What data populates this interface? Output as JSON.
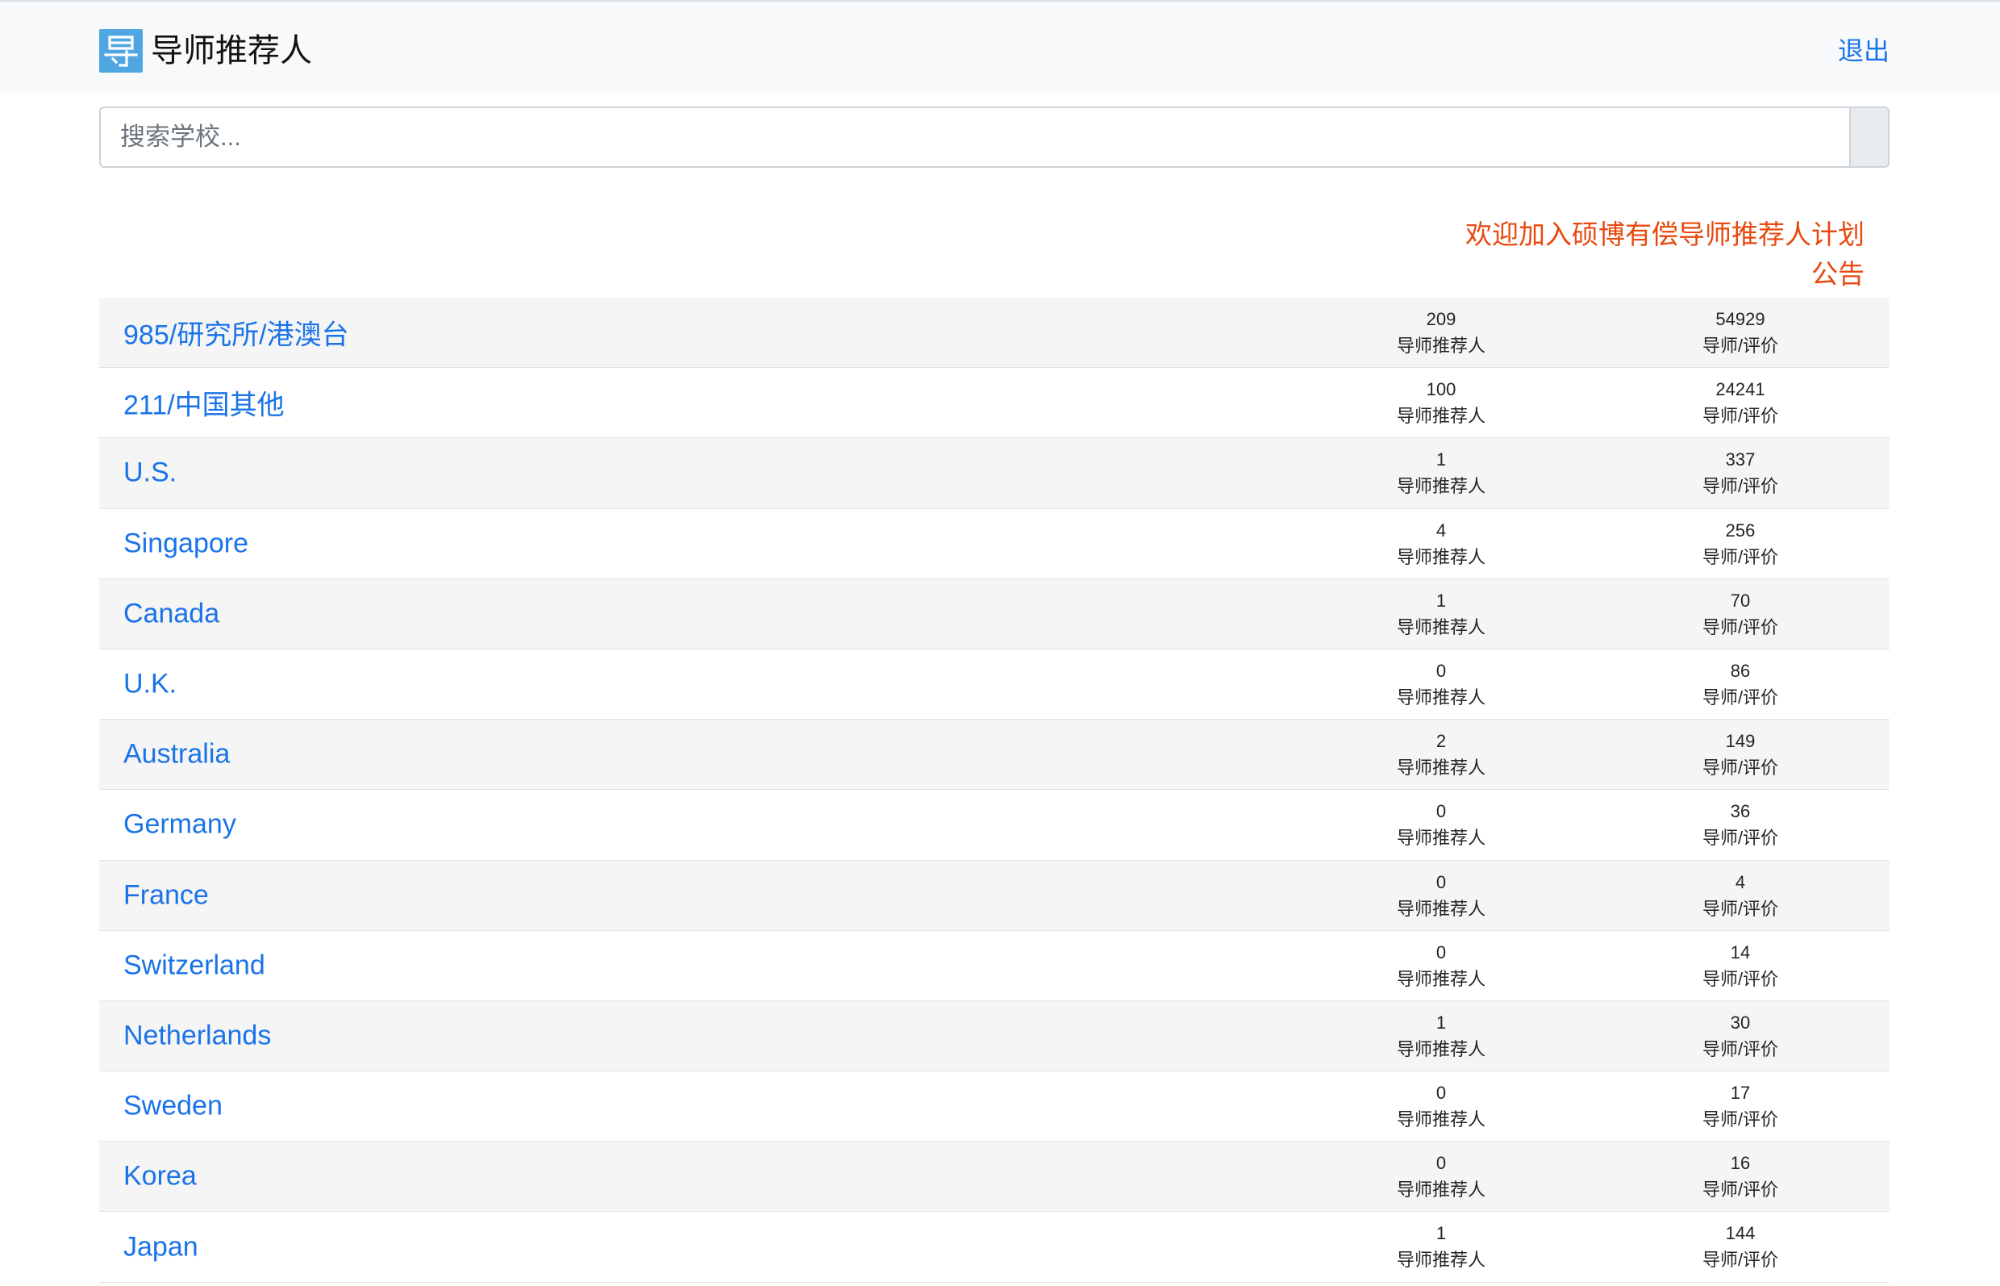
{
  "header": {
    "brand_title": "导师推荐人",
    "logout_label": "退出"
  },
  "search": {
    "placeholder": "搜索学校..."
  },
  "notice": {
    "line1": "欢迎加入硕博有偿导师推荐人计划",
    "line2": "公告"
  },
  "colors": {
    "link": "#1a73e8",
    "notice": "#e8490f",
    "logo": "#4fa6e0"
  },
  "icons": {
    "logo": "dao-logo-icon"
  },
  "rows": [
    {
      "name": "985/研究所/港澳台",
      "recommenders": "209",
      "recommenders_label": "导师推荐人",
      "reviews": "54929",
      "reviews_label": "导师/评价"
    },
    {
      "name": "211/中国其他",
      "recommenders": "100",
      "recommenders_label": "导师推荐人",
      "reviews": "24241",
      "reviews_label": "导师/评价"
    },
    {
      "name": "U.S.",
      "recommenders": "1",
      "recommenders_label": "导师推荐人",
      "reviews": "337",
      "reviews_label": "导师/评价"
    },
    {
      "name": "Singapore",
      "recommenders": "4",
      "recommenders_label": "导师推荐人",
      "reviews": "256",
      "reviews_label": "导师/评价"
    },
    {
      "name": "Canada",
      "recommenders": "1",
      "recommenders_label": "导师推荐人",
      "reviews": "70",
      "reviews_label": "导师/评价"
    },
    {
      "name": "U.K.",
      "recommenders": "0",
      "recommenders_label": "导师推荐人",
      "reviews": "86",
      "reviews_label": "导师/评价"
    },
    {
      "name": "Australia",
      "recommenders": "2",
      "recommenders_label": "导师推荐人",
      "reviews": "149",
      "reviews_label": "导师/评价"
    },
    {
      "name": "Germany",
      "recommenders": "0",
      "recommenders_label": "导师推荐人",
      "reviews": "36",
      "reviews_label": "导师/评价"
    },
    {
      "name": "France",
      "recommenders": "0",
      "recommenders_label": "导师推荐人",
      "reviews": "4",
      "reviews_label": "导师/评价"
    },
    {
      "name": "Switzerland",
      "recommenders": "0",
      "recommenders_label": "导师推荐人",
      "reviews": "14",
      "reviews_label": "导师/评价"
    },
    {
      "name": "Netherlands",
      "recommenders": "1",
      "recommenders_label": "导师推荐人",
      "reviews": "30",
      "reviews_label": "导师/评价"
    },
    {
      "name": "Sweden",
      "recommenders": "0",
      "recommenders_label": "导师推荐人",
      "reviews": "17",
      "reviews_label": "导师/评价"
    },
    {
      "name": "Korea",
      "recommenders": "0",
      "recommenders_label": "导师推荐人",
      "reviews": "16",
      "reviews_label": "导师/评价"
    },
    {
      "name": "Japan",
      "recommenders": "1",
      "recommenders_label": "导师推荐人",
      "reviews": "144",
      "reviews_label": "导师/评价"
    }
  ]
}
